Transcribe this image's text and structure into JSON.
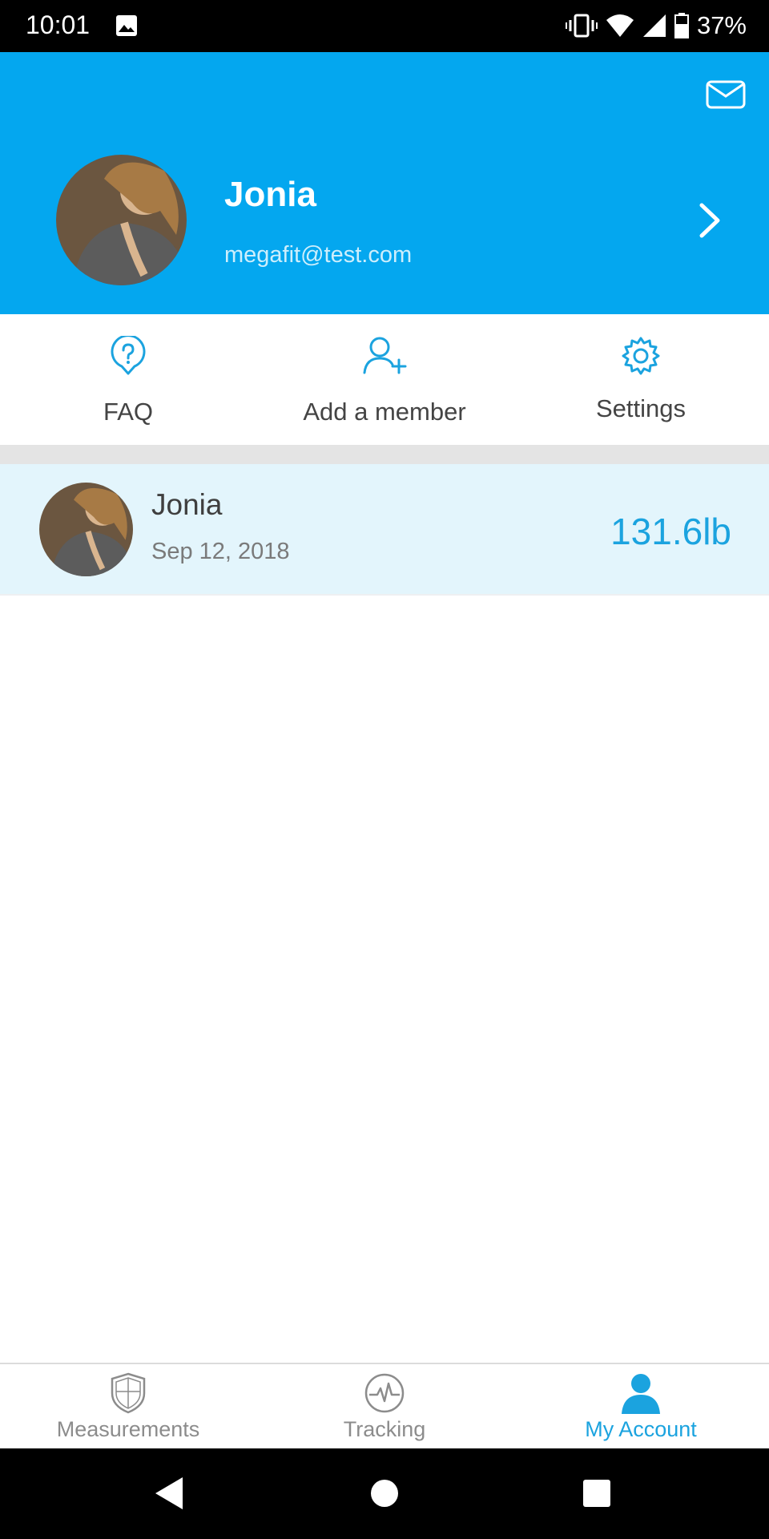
{
  "status_bar": {
    "time": "10:01",
    "battery_percent": "37%"
  },
  "header": {
    "name": "Jonia",
    "email": "megafit@test.com",
    "background_color": "#04a7ef"
  },
  "quick_actions": [
    {
      "label": "FAQ",
      "icon": "question-circle-icon"
    },
    {
      "label": "Add a member",
      "icon": "add-person-icon"
    },
    {
      "label": "Settings",
      "icon": "gear-icon"
    }
  ],
  "member": {
    "name": "Jonia",
    "date": "Sep 12, 2018",
    "weight": "131.6lb"
  },
  "bottom_nav": [
    {
      "label": "Measurements",
      "icon": "shield-icon",
      "active": false
    },
    {
      "label": "Tracking",
      "icon": "heartbeat-icon",
      "active": false
    },
    {
      "label": "My Account",
      "icon": "person-icon",
      "active": true
    }
  ],
  "colors": {
    "accent": "#1ba3df",
    "member_row_bg": "#e3f5fc"
  }
}
